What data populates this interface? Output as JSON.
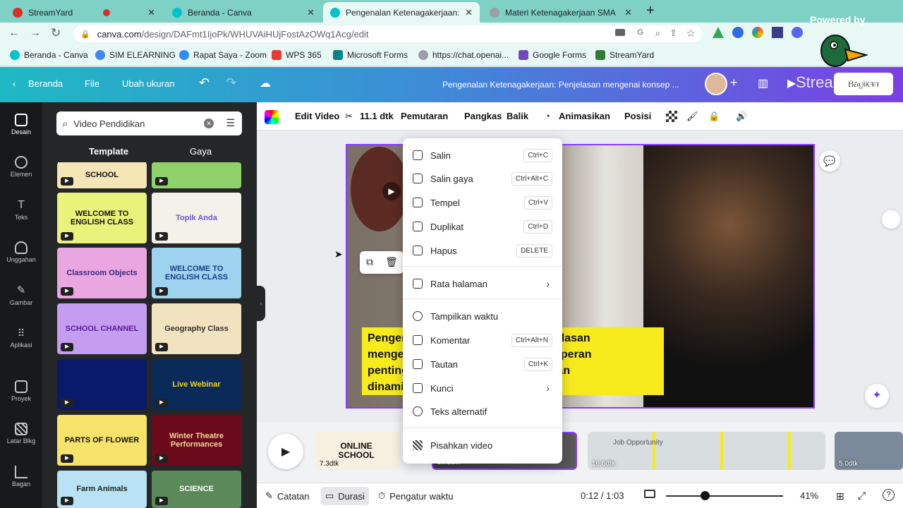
{
  "browser": {
    "tabs": [
      {
        "title": "StreamYard",
        "favicon_color": "#d93025"
      },
      {
        "title": "Beranda - Canva",
        "favicon_color": "#00c4cc"
      },
      {
        "title": "Pengenalan Ketenagakerjaan: P",
        "favicon_color": "#00c4cc"
      },
      {
        "title": "Materi Ketenagakerjaan SMA",
        "favicon_color": "#9aa0a6"
      }
    ],
    "new_tab": "+",
    "url_host": "canva.com",
    "url_path": "/design/DAFmt1IjoPk/WHUVAiHUjFostAzOWq1Acg/edit",
    "bookmarks": [
      {
        "label": "Beranda - Canva",
        "color": "#00c4cc"
      },
      {
        "label": "SIM ELEARNING",
        "color": "#4285f4"
      },
      {
        "label": "Rapat Saya - Zoom",
        "color": "#2d8cff"
      },
      {
        "label": "WPS 365",
        "color": "#e53935"
      },
      {
        "label": "Microsoft Forms",
        "color": "#038387"
      },
      {
        "label": "https://chat.openai...",
        "color": "#9aa0a6"
      },
      {
        "label": "Google Forms",
        "color": "#7248b9"
      },
      {
        "label": "StreamYard",
        "color": "#2e7d32"
      }
    ]
  },
  "canva_header": {
    "back": "Beranda",
    "file": "File",
    "resize": "Ubah ukuran",
    "doc_title": "Pengenalan Ketenagakerjaan: Penjelasan mengenai konsep ...",
    "share": "Bagikan"
  },
  "rail": [
    {
      "label": "Desain"
    },
    {
      "label": "Elemen"
    },
    {
      "label": "Teks"
    },
    {
      "label": "Unggahan"
    },
    {
      "label": "Gambar"
    },
    {
      "label": "Aplikasi"
    },
    {
      "label": "Proyek"
    },
    {
      "label": "Latar Blkg"
    },
    {
      "label": "Bagan"
    }
  ],
  "panel": {
    "search_value": "Video Pendidikan",
    "tabs": [
      "Template",
      "Gaya"
    ],
    "thumbs": [
      {
        "text": "SCHOOL",
        "bg": "#f5e6b8",
        "fg": "#111"
      },
      {
        "text": "",
        "bg": "#8fd16a",
        "fg": "#111"
      },
      {
        "text": "WELCOME TO ENGLISH CLASS",
        "bg": "#e9f27a",
        "fg": "#111"
      },
      {
        "text": "Topik Anda",
        "bg": "#f4f0ea",
        "fg": "#6a5acd"
      },
      {
        "text": "Classroom Objects",
        "bg": "#e9a6e0",
        "fg": "#3a2a80"
      },
      {
        "text": "WELCOME TO ENGLISH CLASS",
        "bg": "#9ed3f0",
        "fg": "#1a3a8a"
      },
      {
        "text": "SCHOOL CHANNEL",
        "bg": "#c59df0",
        "fg": "#5a1a9a"
      },
      {
        "text": "Geography Class",
        "bg": "#f2e3c0",
        "fg": "#333"
      },
      {
        "text": "",
        "bg": "#0a1a6a",
        "fg": "#fff"
      },
      {
        "text": "Live Webinar",
        "bg": "#0a2a5a",
        "fg": "#f7d21d"
      },
      {
        "text": "PARTS OF FLOWER",
        "bg": "#f7e36b",
        "fg": "#111"
      },
      {
        "text": "Winter Theatre Performances",
        "bg": "#6a0a1a",
        "fg": "#f6d6a0"
      },
      {
        "text": "Farm Animals",
        "bg": "#b9e3f5",
        "fg": "#222"
      },
      {
        "text": "SCIENCE",
        "bg": "#5a8a5a",
        "fg": "#fff"
      }
    ]
  },
  "editor_toolbar": {
    "edit_video": "Edit Video",
    "duration": "11.1 dtk",
    "playback": "Pemutaran",
    "crop": "Pangkas",
    "flip": "Balik",
    "animate": "Animasikan",
    "position": "Posisi"
  },
  "canvas": {
    "subtitle_lines": [
      "Pengenalan Ketenagakerjaan:  Penjelasan",
      "mengenai konsep ketenagakerjaan,  peran",
      "pentingnya dalam perekonomian, dan",
      "dinamika pasar tenaga kerja"
    ]
  },
  "context_menu": {
    "items": [
      {
        "label": "Salin",
        "shortcut": "Ctrl+C"
      },
      {
        "label": "Salin gaya",
        "shortcut": "Ctrl+Alt+C"
      },
      {
        "label": "Tempel",
        "shortcut": "Ctrl+V"
      },
      {
        "label": "Duplikat",
        "shortcut": "Ctrl+D"
      },
      {
        "label": "Hapus",
        "shortcut": "DELETE"
      },
      {
        "label": "Rata halaman",
        "shortcut": ""
      },
      {
        "label": "Tampilkan waktu",
        "shortcut": ""
      },
      {
        "label": "Komentar",
        "shortcut": "Ctrl+Alt+N"
      },
      {
        "label": "Tautan",
        "shortcut": "Ctrl+K"
      },
      {
        "label": "Kunci",
        "shortcut": ""
      },
      {
        "label": "Teks alternatif",
        "shortcut": ""
      },
      {
        "label": "Pisahkan video",
        "shortcut": ""
      }
    ]
  },
  "timeline": {
    "clips": [
      {
        "label": "ONLINE SCHOOL",
        "dur": "7.3dtk",
        "bg": "#f6f0e0"
      },
      {
        "label": "",
        "dur": "10.2dtk",
        "bg": "#3a3a3a"
      },
      {
        "label": "Job Opportunity",
        "dur": "16.6dtk",
        "bg": "#d8dde0"
      },
      {
        "label": "",
        "dur": "5.0dtk",
        "bg": "#7a8a9a"
      }
    ]
  },
  "footer": {
    "notes": "Catatan",
    "duration": "Durasi",
    "timer": "Pengatur waktu",
    "time": "0:12 / 1:03",
    "zoom": "41%",
    "zoom_fraction": 0.33
  },
  "overlay": {
    "powered_by": "Powered by",
    "streamyard": "StreamYard"
  }
}
